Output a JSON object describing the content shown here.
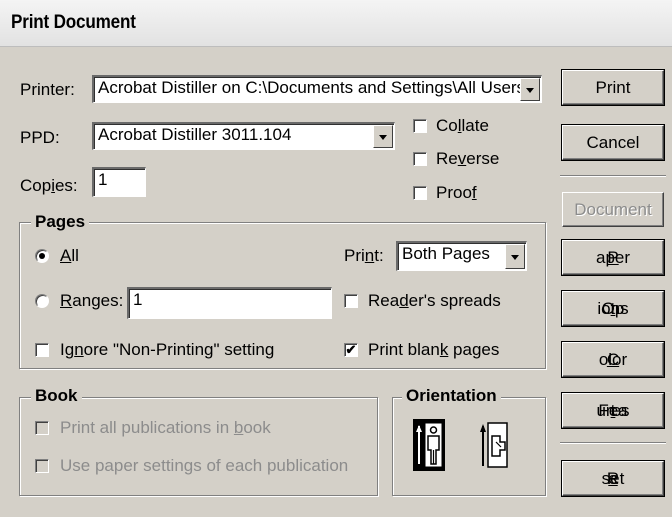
{
  "window": {
    "title": "Print Document"
  },
  "printer": {
    "label_pre": "Printer:",
    "value": "Acrobat Distiller on C:\\Documents and Settings\\All Users"
  },
  "ppd": {
    "label": "PPD:",
    "value": "Acrobat Distiller 3011.104"
  },
  "copies": {
    "label_pre": "Cop",
    "label_u": "i",
    "label_post": "es:",
    "value": "1"
  },
  "options": {
    "collate": {
      "pre": "Co",
      "u": "l",
      "post": "late",
      "checked": false
    },
    "reverse": {
      "pre": "Re",
      "u": "v",
      "post": "erse",
      "checked": false
    },
    "proof": {
      "pre": "Proo",
      "u": "f",
      "post": "",
      "checked": false
    }
  },
  "pages": {
    "title": "Pages",
    "all": {
      "u": "A",
      "post": "ll",
      "selected": true
    },
    "ranges": {
      "u": "R",
      "post": "anges:",
      "value": "1",
      "selected": false
    },
    "ignore_nonprinting": {
      "pre": "Ig",
      "u": "n",
      "post": "ore \"Non-Printing\" setting",
      "checked": false
    },
    "print_label": {
      "pre": "Pri",
      "u": "n",
      "post": "t:"
    },
    "print_value": "Both Pages",
    "readers_spreads": {
      "pre": "Rea",
      "u": "d",
      "post": "er's spreads",
      "checked": false
    },
    "print_blank": {
      "pre": "Print blan",
      "u": "k",
      "post": " pages",
      "checked": true
    }
  },
  "book": {
    "title": "Book",
    "print_all": {
      "pre": "Print all publications in ",
      "u": "b",
      "post": "ook",
      "checked": false
    },
    "use_paper": {
      "pre": "Use paper settings of each publication",
      "checked": false
    }
  },
  "orientation": {
    "title": "Orientation",
    "selected": "portrait"
  },
  "buttons": {
    "print": "Print",
    "cancel": "Cancel",
    "document": "Document",
    "paper": {
      "u": "P",
      "post": "aper"
    },
    "options": {
      "pre": "Op",
      "u": "t",
      "post": "ions"
    },
    "color": {
      "u": "C",
      "post": "olor"
    },
    "features": {
      "pre": "Fea",
      "u": "t",
      "post": "ures"
    },
    "reset": {
      "pre": "R",
      "u": "e",
      "post": "set"
    }
  }
}
